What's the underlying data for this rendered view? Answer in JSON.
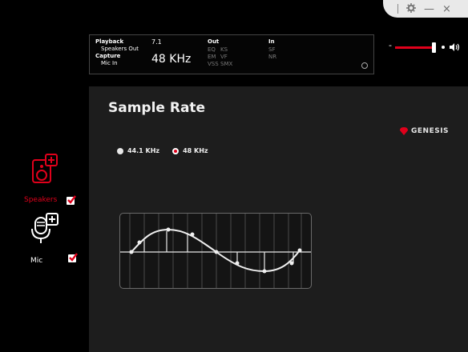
{
  "window": {
    "controls": {
      "settings_icon": "gear-icon",
      "minimize_label": "—",
      "close_label": "×"
    }
  },
  "status": {
    "playback_label": "Playback",
    "playback_device": "Speakers Out",
    "channels": "7.1",
    "capture_label": "Capture",
    "capture_device": "Mic In",
    "sample_rate": "48 KHz",
    "out_label": "Out",
    "out_effects": [
      "EQ",
      "KS",
      "EM",
      "VF",
      "VSS",
      "SMX"
    ],
    "in_label": "In",
    "in_effects": [
      "SF",
      "NR"
    ]
  },
  "volume": {
    "level": 0.85,
    "icon": "speaker-icon"
  },
  "main": {
    "title": "Sample Rate",
    "brand": "GENESIS",
    "options": [
      {
        "label": "44.1 KHz",
        "selected": false
      },
      {
        "label": "48 KHz",
        "selected": true
      }
    ]
  },
  "sidebar": {
    "items": [
      {
        "label": "Speakers",
        "checked": true,
        "active": true,
        "icon": "speaker-device-icon"
      },
      {
        "label": "Mic",
        "checked": true,
        "active": false,
        "icon": "microphone-icon"
      }
    ]
  },
  "colors": {
    "accent": "#e0001b",
    "panel": "#1d1d1d",
    "background": "#000000"
  }
}
